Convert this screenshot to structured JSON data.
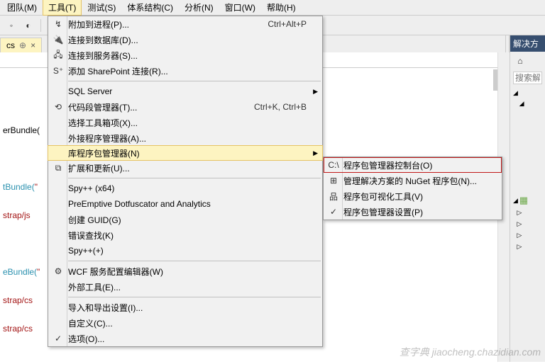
{
  "menubar": {
    "items": [
      {
        "label": "团队(M)"
      },
      {
        "label": "工具(T)"
      },
      {
        "label": "测试(S)"
      },
      {
        "label": "体系结构(C)"
      },
      {
        "label": "分析(N)"
      },
      {
        "label": "窗口(W)"
      },
      {
        "label": "帮助(H)"
      }
    ]
  },
  "tab": {
    "name": "cs",
    "pin_glyph": "⊕",
    "close_glyph": "×"
  },
  "code": {
    "lines": [
      {
        "pre": "",
        "str": "erBundle("
      },
      {
        "pre": "",
        "str": ""
      },
      {
        "pre": "tBundle(",
        "str": "\""
      },
      {
        "pre": "strap/js",
        "str": ""
      },
      {
        "pre": "",
        "str": ""
      },
      {
        "pre": "eBundle(",
        "str": "\""
      },
      {
        "pre": "strap/cs",
        "str": ""
      },
      {
        "pre": "strap/cs",
        "str": ""
      }
    ]
  },
  "tools_menu": [
    {
      "type": "item",
      "icon": "↯",
      "label": "附加到进程(P)...",
      "shortcut": "Ctrl+Alt+P"
    },
    {
      "type": "item",
      "icon": "🔌",
      "label": "连接到数据库(D)..."
    },
    {
      "type": "item",
      "icon": "🖧",
      "label": "连接到服务器(S)..."
    },
    {
      "type": "item",
      "icon": "S⁺",
      "label": "添加 SharePoint 连接(R)..."
    },
    {
      "type": "sep"
    },
    {
      "type": "item",
      "label": "SQL Server",
      "submenu": true
    },
    {
      "type": "item",
      "icon": "⟲",
      "label": "代码段管理器(T)...",
      "shortcut": "Ctrl+K, Ctrl+B"
    },
    {
      "type": "item",
      "label": "选择工具箱项(X)..."
    },
    {
      "type": "item",
      "label": "外接程序管理器(A)..."
    },
    {
      "type": "item",
      "label": "库程序包管理器(N)",
      "submenu": true,
      "highlight": true
    },
    {
      "type": "item",
      "icon": "⧉",
      "label": "扩展和更新(U)..."
    },
    {
      "type": "sep"
    },
    {
      "type": "item",
      "label": "Spy++ (x64)"
    },
    {
      "type": "item",
      "label": "PreEmptive Dotfuscator and Analytics"
    },
    {
      "type": "item",
      "label": "创建 GUID(G)"
    },
    {
      "type": "item",
      "label": "错误查找(K)"
    },
    {
      "type": "item",
      "label": "Spy++(+)"
    },
    {
      "type": "sep"
    },
    {
      "type": "item",
      "icon": "⚙",
      "label": "WCF 服务配置编辑器(W)"
    },
    {
      "type": "item",
      "label": "外部工具(E)..."
    },
    {
      "type": "sep"
    },
    {
      "type": "item",
      "label": "导入和导出设置(I)..."
    },
    {
      "type": "item",
      "label": "自定义(C)..."
    },
    {
      "type": "item",
      "icon": "✓",
      "label": "选项(O)..."
    }
  ],
  "sub_menu": [
    {
      "icon": "C:\\",
      "label": "程序包管理器控制台(O)",
      "selected": true
    },
    {
      "icon": "⊞",
      "label": "管理解决方案的 NuGet 程序包(N)..."
    },
    {
      "icon": "品",
      "label": "程序包可视化工具(V)"
    },
    {
      "icon": "✓",
      "label": "程序包管理器设置(P)"
    }
  ],
  "solution": {
    "header": "解决方",
    "search_placeholder": "搜索解"
  },
  "watermark": "查字典 jiaocheng.chazidian.com"
}
